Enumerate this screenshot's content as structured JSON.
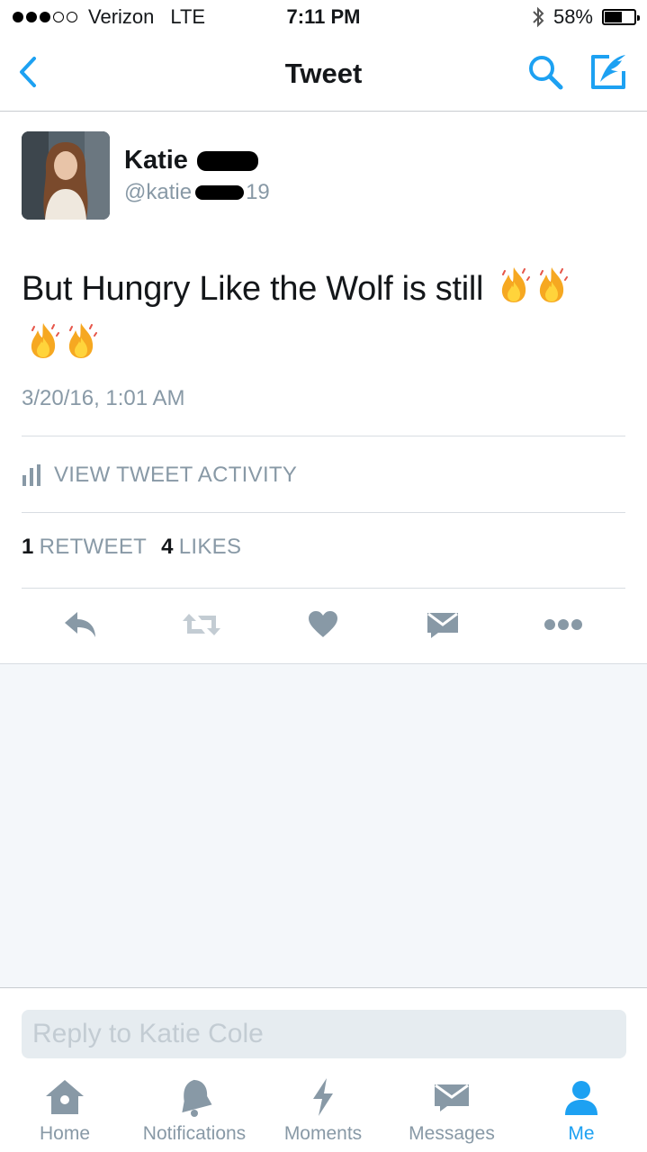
{
  "status_bar": {
    "carrier": "Verizon",
    "network": "LTE",
    "time": "7:11 PM",
    "battery": "58%",
    "battery_level": 0.58,
    "signal_bars": 3,
    "signal_max": 5
  },
  "nav": {
    "title": "Tweet",
    "back_icon": "chevron-left-icon",
    "search_icon": "search-icon",
    "compose_icon": "compose-quill-icon"
  },
  "tweet": {
    "name": "Katie",
    "handle_prefix": "@katie",
    "handle_suffix": "19",
    "text": "But Hungry Like the Wolf is still",
    "emoji_count": 4,
    "timestamp": "3/20/16, 1:01 AM",
    "activity_label": "VIEW TWEET ACTIVITY",
    "retweet_count": "1",
    "retweet_label": "RETWEET",
    "like_count": "4",
    "like_label": "LIKES"
  },
  "reply": {
    "placeholder": "Reply to Katie Cole"
  },
  "tabs": [
    {
      "label": "Home",
      "icon": "home-icon",
      "active": false
    },
    {
      "label": "Notifications",
      "icon": "bell-icon",
      "active": false
    },
    {
      "label": "Moments",
      "icon": "lightning-icon",
      "active": false
    },
    {
      "label": "Messages",
      "icon": "envelope-icon",
      "active": false
    },
    {
      "label": "Me",
      "icon": "person-icon",
      "active": true
    }
  ],
  "colors": {
    "accent": "#1da1f2",
    "muted": "#8899a6",
    "text": "#14171a",
    "background_gray": "#f4f7fa"
  }
}
